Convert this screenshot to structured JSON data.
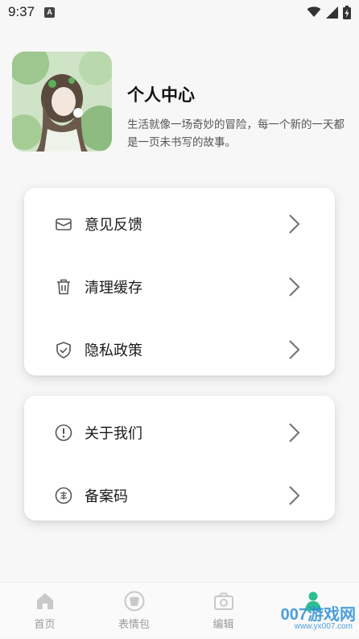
{
  "status_bar": {
    "time": "9:37",
    "app_badge": "A",
    "icons": [
      "wifi-icon",
      "signal-icon",
      "battery-charging-icon"
    ]
  },
  "profile": {
    "avatar": "anime-girl-avatar",
    "title": "个人中心",
    "description": "生活就像一场奇妙的冒险，每一个新的一天都是一页未书写的故事。"
  },
  "menu_group_1": [
    {
      "label": "意见反馈",
      "icon": "mail-icon"
    },
    {
      "label": "清理缓存",
      "icon": "trash-icon"
    },
    {
      "label": "隐私政策",
      "icon": "shield-check-icon"
    }
  ],
  "menu_group_2": [
    {
      "label": "关于我们",
      "icon": "info-circle-icon"
    },
    {
      "label": "备案码",
      "icon": "record-badge-icon"
    }
  ],
  "tab_bar": [
    {
      "label": "首页",
      "icon": "home-icon"
    },
    {
      "label": "表情包",
      "icon": "sticker-icon"
    },
    {
      "label": "编辑",
      "icon": "camera-icon"
    },
    {
      "label": "我的",
      "icon": "user-icon"
    }
  ],
  "watermark": {
    "text": "007游戏网",
    "url": "www.yx007.com"
  },
  "colors": {
    "accent": "#2fbf8f",
    "background": "#f7f7f7",
    "card": "#ffffff"
  }
}
